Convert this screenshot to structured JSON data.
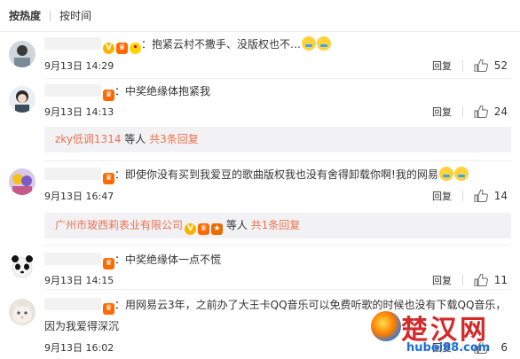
{
  "sort_tabs": [
    {
      "label": "按热度"
    },
    {
      "label": "按时间"
    }
  ],
  "comments": [
    {
      "text": "：抱紧云村不撒手、没版权也不…",
      "date": "9月13日 14:29",
      "reply": "回复",
      "likes": "52",
      "badges": [
        "v-icon",
        "vip-icon",
        "bulb-icon"
      ],
      "emojis": 2
    },
    {
      "text": "：中奖绝缘体抱紧我",
      "date": "9月13日 14:13",
      "reply": "回复",
      "likes": "24",
      "badges": [
        "vip-icon"
      ],
      "sub": {
        "user": "zky低调1314",
        "middle": " 等人 ",
        "count": "共3条回复"
      }
    },
    {
      "text": "：即使你没有买到我爱豆的歌曲版权我也没有舍得卸载你啊!我的网易",
      "date": "9月13日 16:47",
      "reply": "回复",
      "likes": "14",
      "badges": [
        "vip-icon"
      ],
      "emojis": 2,
      "sub": {
        "user": "广州市玻西莉表业有限公司",
        "middle": " 等人 ",
        "count": "共1条回复"
      }
    },
    {
      "text": "：中奖绝缘体一点不慌",
      "date": "9月13日 14:15",
      "reply": "回复",
      "likes": "11",
      "badges": [
        "vip-icon"
      ]
    },
    {
      "text": "：用网易云3年，之前办了大王卡QQ音乐可以免费听歌的时候也没有下载QQ音乐，",
      "text2": "因为我爱得深沉",
      "date": "9月13日 16:02",
      "reply": "回复",
      "likes": "6",
      "badges": [
        "vip-icon"
      ]
    }
  ],
  "watermark": {
    "title": "楚汉网",
    "url": "hubei88.com"
  },
  "colors": {
    "link": "#eb7350",
    "subbox_bg": "#f2f2f5"
  }
}
